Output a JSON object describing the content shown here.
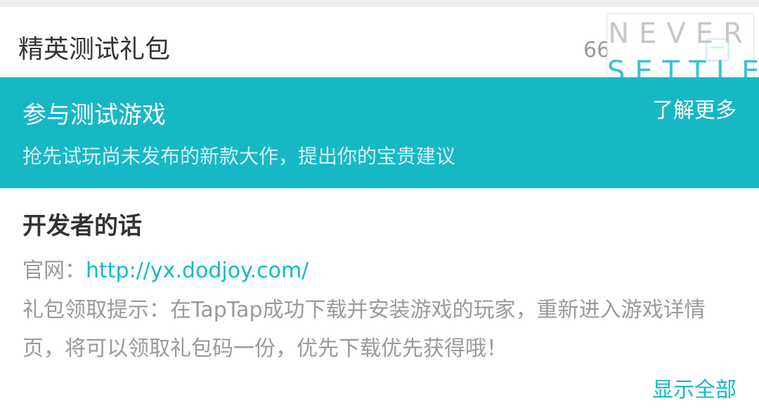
{
  "gift": {
    "title": "精英测试礼包",
    "count": "66",
    "icon": "gift-box-icon"
  },
  "watermark": {
    "line1": "NEVER",
    "line2": "SETTLE"
  },
  "beta_banner": {
    "title": "参与测试游戏",
    "more_label": "了解更多",
    "subtitle": "抢先试玩尚未发布的新款大作，提出你的宝贵建议",
    "background": "#16b8c6"
  },
  "developer": {
    "heading": "开发者的话",
    "site_label": "官网：",
    "site_url": "http://yx.dodjoy.com/",
    "note": "礼包领取提示：在TapTap成功下载并安装游戏的玩家，重新进入游戏详情页，将可以领取礼包码一份，优先下载优先获得哦！",
    "show_all_label": "显示全部"
  },
  "colors": {
    "accent": "#14b9c8",
    "text_primary": "#333333",
    "text_secondary": "#9a9a9a"
  }
}
